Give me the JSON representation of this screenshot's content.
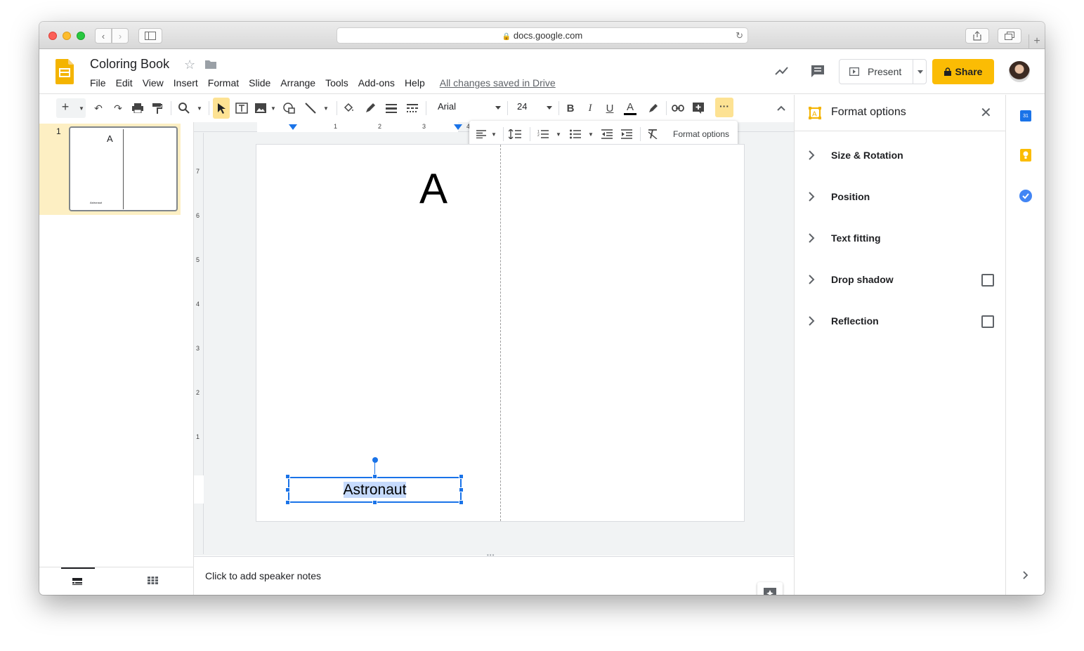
{
  "browser": {
    "url": "docs.google.com"
  },
  "doc": {
    "title": "Coloring Book",
    "saved_status": "All changes saved in Drive"
  },
  "menu": [
    "File",
    "Edit",
    "View",
    "Insert",
    "Format",
    "Slide",
    "Arrange",
    "Tools",
    "Add-ons",
    "Help"
  ],
  "header_buttons": {
    "present": "Present",
    "share": "Share"
  },
  "toolbar": {
    "font": "Arial",
    "font_size": "24",
    "format_options": "Format options"
  },
  "ruler": {
    "top_ticks": [
      "1",
      "2",
      "3",
      "4"
    ],
    "left_ticks": [
      "7",
      "6",
      "5",
      "4",
      "3",
      "2",
      "1"
    ]
  },
  "filmstrip": {
    "slides": [
      {
        "number": "1",
        "letter": "A",
        "caption": "Astronaut"
      }
    ]
  },
  "slide": {
    "letter": "A",
    "caption": "Astronaut"
  },
  "notes": {
    "placeholder": "Click to add speaker notes"
  },
  "format_panel": {
    "title": "Format options",
    "sections": [
      {
        "label": "Size & Rotation",
        "has_checkbox": false
      },
      {
        "label": "Position",
        "has_checkbox": false
      },
      {
        "label": "Text fitting",
        "has_checkbox": false
      },
      {
        "label": "Drop shadow",
        "has_checkbox": true
      },
      {
        "label": "Reflection",
        "has_checkbox": true
      }
    ]
  },
  "side_apps": {
    "calendar_day": "31"
  },
  "colors": {
    "accent_yellow": "#f4b400",
    "share_bg": "#fbbc04",
    "selection_blue": "#1a73e8",
    "highlight": "#c6dafc",
    "filmstrip_selected": "#fdefc3"
  }
}
